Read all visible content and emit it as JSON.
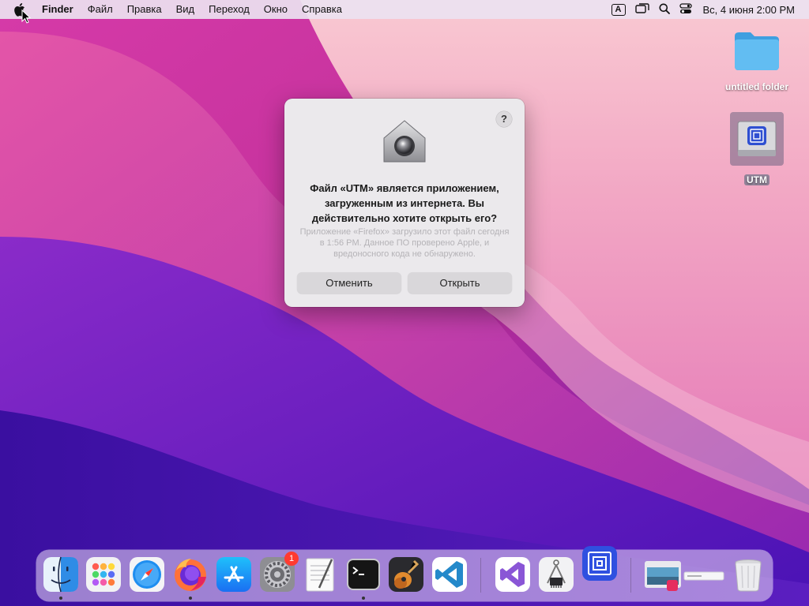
{
  "menubar": {
    "app_name": "Finder",
    "items": [
      "Файл",
      "Правка",
      "Вид",
      "Переход",
      "Окно",
      "Справка"
    ],
    "input_source": "A",
    "clock": "Вс, 4 июня  2:00 PM"
  },
  "desktop": {
    "icons": [
      {
        "label": "untitled folder",
        "icon": "folder-icon"
      },
      {
        "label": "UTM",
        "icon": "utm-disk-icon",
        "selected": true
      }
    ]
  },
  "dialog": {
    "icon": "gatekeeper-icon",
    "help": "?",
    "title": "Файл «UTM» является приложением, загруженным из интернета. Вы действительно хотите открыть его?",
    "info": "Приложение «Firefox» загрузило этот файл сегодня в 1:56 PM. Данное ПО проверено Apple, и вредоносного кода не обнаружено.",
    "cancel_label": "Отменить",
    "open_label": "Открыть"
  },
  "dock": {
    "items": [
      {
        "name": "Finder",
        "icon": "finder-icon",
        "running": true
      },
      {
        "name": "Launchpad",
        "icon": "launchpad-icon"
      },
      {
        "name": "Safari",
        "icon": "safari-icon"
      },
      {
        "name": "Firefox",
        "icon": "firefox-icon",
        "running": true
      },
      {
        "name": "App Store",
        "icon": "app-store-icon"
      },
      {
        "name": "System Preferences",
        "icon": "system-preferences-icon",
        "badge": "1"
      },
      {
        "name": "TextEdit",
        "icon": "textedit-icon"
      },
      {
        "name": "Terminal",
        "icon": "terminal-icon",
        "running": true
      },
      {
        "name": "GarageBand",
        "icon": "garageband-icon"
      },
      {
        "name": "Visual Studio Code",
        "icon": "vscode-icon"
      },
      {
        "name": "Visual Studio",
        "icon": "visual-studio-icon"
      },
      {
        "name": "System Information",
        "icon": "system-information-icon"
      },
      {
        "name": "UTM",
        "icon": "utm-icon"
      },
      {
        "name": "Downloads",
        "icon": "downloads-stack-icon"
      },
      {
        "name": "Trash",
        "icon": "trash-icon"
      }
    ]
  },
  "colors": {
    "accent": "#3a7bd5",
    "badge": "#ff3b30",
    "folder": "#5ab8f0"
  }
}
